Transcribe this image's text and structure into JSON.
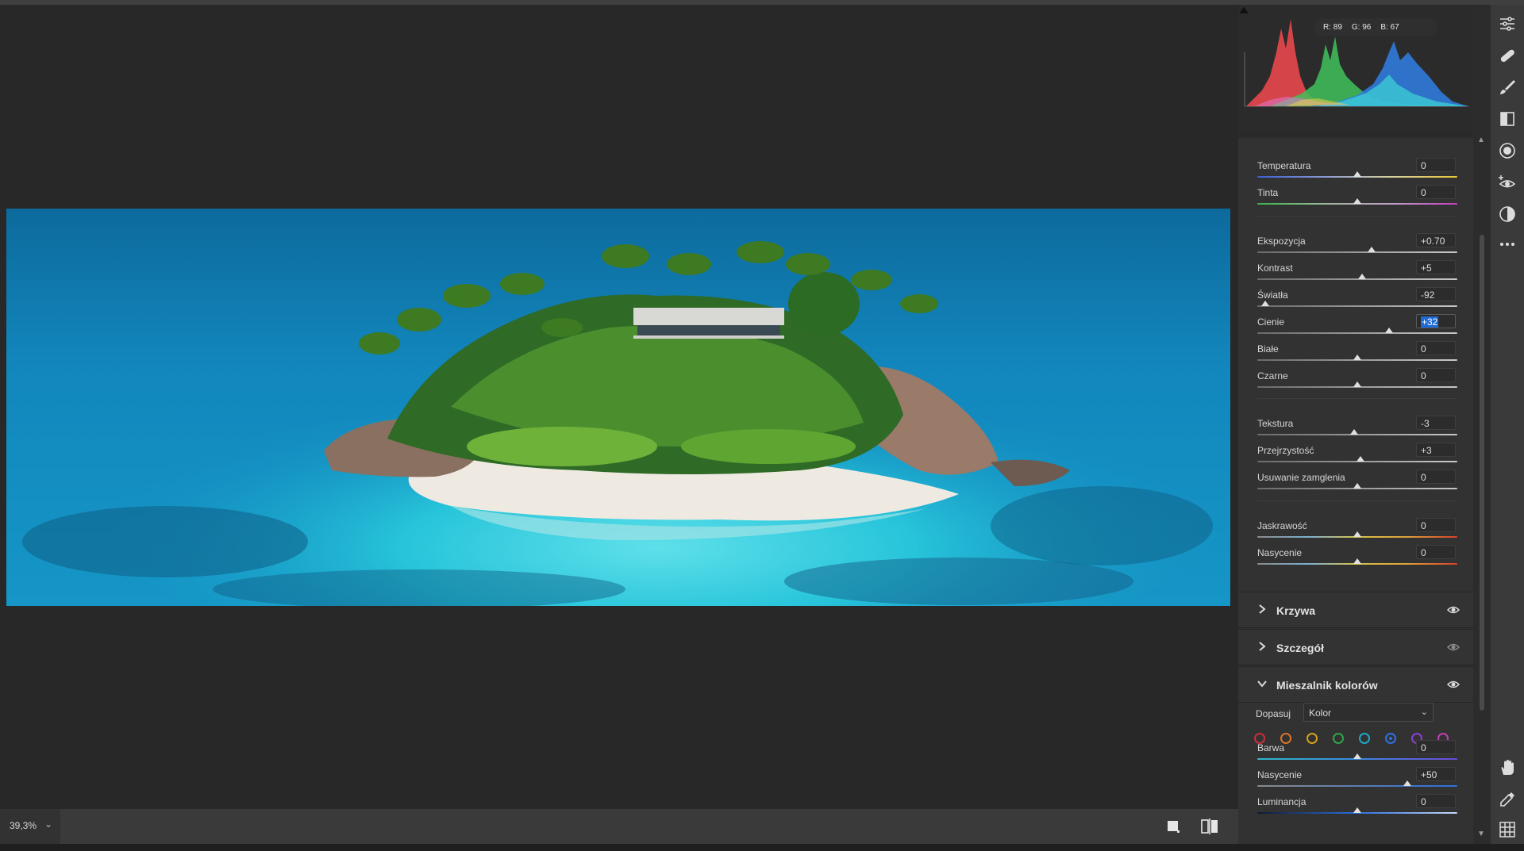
{
  "colors": {
    "accent": "#1f6bd6",
    "panel_bg": "#323232",
    "canvas_bg": "#282828"
  },
  "histogram": {
    "readout": {
      "r": "R: 89",
      "g": "G: 96",
      "b": "B: 67"
    }
  },
  "basic": {
    "sliders": [
      {
        "label": "Temperatura",
        "value": "0",
        "position": 0.5,
        "track": "temperature"
      },
      {
        "label": "Tinta",
        "value": "0",
        "position": 0.5,
        "track": "tint"
      },
      {
        "label": "Ekspozycja",
        "value": "+0.70",
        "position": 0.57,
        "track": "neutral"
      },
      {
        "label": "Kontrast",
        "value": "+5",
        "position": 0.525,
        "track": "neutral"
      },
      {
        "label": "Światła",
        "value": "-92",
        "position": 0.04,
        "track": "neutral"
      },
      {
        "label": "Cienie",
        "value": "+32",
        "position": 0.66,
        "track": "neutral",
        "active": true
      },
      {
        "label": "Białe",
        "value": "0",
        "position": 0.5,
        "track": "neutral"
      },
      {
        "label": "Czarne",
        "value": "0",
        "position": 0.5,
        "track": "neutral"
      },
      {
        "label": "Tekstura",
        "value": "-3",
        "position": 0.485,
        "track": "neutral"
      },
      {
        "label": "Przejrzystość",
        "value": "+3",
        "position": 0.515,
        "track": "neutral"
      },
      {
        "label": "Usuwanie zamglenia",
        "value": "0",
        "position": 0.5,
        "track": "neutral"
      },
      {
        "label": "Jaskrawość",
        "value": "0",
        "position": 0.5,
        "track": "vibrance"
      },
      {
        "label": "Nasycenie",
        "value": "0",
        "position": 0.5,
        "track": "vibrance"
      }
    ]
  },
  "sections": {
    "curves": "Krzywa",
    "detail": "Szczegół",
    "color_mixer": "Mieszalnik kolorów"
  },
  "color_mixer": {
    "adjust_label": "Dopasuj",
    "adjust_value": "Kolor",
    "colors": [
      "#c8303a",
      "#d9742a",
      "#d4a21c",
      "#2fa44a",
      "#1fa8c8",
      "#2b6fe0",
      "#8a3fd6",
      "#c23fb0"
    ],
    "selected_index": 5,
    "sliders": [
      {
        "label": "Barwa",
        "value": "0",
        "position": 0.5,
        "track": "hue_blue"
      },
      {
        "label": "Nasycenie",
        "value": "+50",
        "position": 0.75,
        "track": "sat_blue"
      },
      {
        "label": "Luminancja",
        "value": "0",
        "position": 0.5,
        "track": "lum_blue"
      }
    ]
  },
  "status": {
    "zoom": "39,3%"
  }
}
